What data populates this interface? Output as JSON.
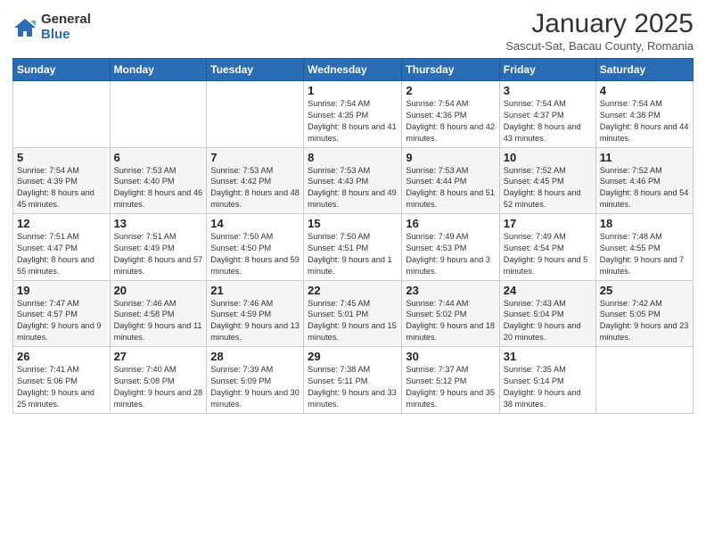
{
  "logo": {
    "general": "General",
    "blue": "Blue"
  },
  "title": "January 2025",
  "subtitle": "Sascut-Sat, Bacau County, Romania",
  "weekdays": [
    "Sunday",
    "Monday",
    "Tuesday",
    "Wednesday",
    "Thursday",
    "Friday",
    "Saturday"
  ],
  "weeks": [
    [
      {
        "day": "",
        "info": ""
      },
      {
        "day": "",
        "info": ""
      },
      {
        "day": "",
        "info": ""
      },
      {
        "day": "1",
        "info": "Sunrise: 7:54 AM\nSunset: 4:35 PM\nDaylight: 8 hours and 41 minutes."
      },
      {
        "day": "2",
        "info": "Sunrise: 7:54 AM\nSunset: 4:36 PM\nDaylight: 8 hours and 42 minutes."
      },
      {
        "day": "3",
        "info": "Sunrise: 7:54 AM\nSunset: 4:37 PM\nDaylight: 8 hours and 43 minutes."
      },
      {
        "day": "4",
        "info": "Sunrise: 7:54 AM\nSunset: 4:38 PM\nDaylight: 8 hours and 44 minutes."
      }
    ],
    [
      {
        "day": "5",
        "info": "Sunrise: 7:54 AM\nSunset: 4:39 PM\nDaylight: 8 hours and 45 minutes."
      },
      {
        "day": "6",
        "info": "Sunrise: 7:53 AM\nSunset: 4:40 PM\nDaylight: 8 hours and 46 minutes."
      },
      {
        "day": "7",
        "info": "Sunrise: 7:53 AM\nSunset: 4:42 PM\nDaylight: 8 hours and 48 minutes."
      },
      {
        "day": "8",
        "info": "Sunrise: 7:53 AM\nSunset: 4:43 PM\nDaylight: 8 hours and 49 minutes."
      },
      {
        "day": "9",
        "info": "Sunrise: 7:53 AM\nSunset: 4:44 PM\nDaylight: 8 hours and 51 minutes."
      },
      {
        "day": "10",
        "info": "Sunrise: 7:52 AM\nSunset: 4:45 PM\nDaylight: 8 hours and 52 minutes."
      },
      {
        "day": "11",
        "info": "Sunrise: 7:52 AM\nSunset: 4:46 PM\nDaylight: 8 hours and 54 minutes."
      }
    ],
    [
      {
        "day": "12",
        "info": "Sunrise: 7:51 AM\nSunset: 4:47 PM\nDaylight: 8 hours and 55 minutes."
      },
      {
        "day": "13",
        "info": "Sunrise: 7:51 AM\nSunset: 4:49 PM\nDaylight: 8 hours and 57 minutes."
      },
      {
        "day": "14",
        "info": "Sunrise: 7:50 AM\nSunset: 4:50 PM\nDaylight: 8 hours and 59 minutes."
      },
      {
        "day": "15",
        "info": "Sunrise: 7:50 AM\nSunset: 4:51 PM\nDaylight: 9 hours and 1 minute."
      },
      {
        "day": "16",
        "info": "Sunrise: 7:49 AM\nSunset: 4:53 PM\nDaylight: 9 hours and 3 minutes."
      },
      {
        "day": "17",
        "info": "Sunrise: 7:49 AM\nSunset: 4:54 PM\nDaylight: 9 hours and 5 minutes."
      },
      {
        "day": "18",
        "info": "Sunrise: 7:48 AM\nSunset: 4:55 PM\nDaylight: 9 hours and 7 minutes."
      }
    ],
    [
      {
        "day": "19",
        "info": "Sunrise: 7:47 AM\nSunset: 4:57 PM\nDaylight: 9 hours and 9 minutes."
      },
      {
        "day": "20",
        "info": "Sunrise: 7:46 AM\nSunset: 4:58 PM\nDaylight: 9 hours and 11 minutes."
      },
      {
        "day": "21",
        "info": "Sunrise: 7:46 AM\nSunset: 4:59 PM\nDaylight: 9 hours and 13 minutes."
      },
      {
        "day": "22",
        "info": "Sunrise: 7:45 AM\nSunset: 5:01 PM\nDaylight: 9 hours and 15 minutes."
      },
      {
        "day": "23",
        "info": "Sunrise: 7:44 AM\nSunset: 5:02 PM\nDaylight: 9 hours and 18 minutes."
      },
      {
        "day": "24",
        "info": "Sunrise: 7:43 AM\nSunset: 5:04 PM\nDaylight: 9 hours and 20 minutes."
      },
      {
        "day": "25",
        "info": "Sunrise: 7:42 AM\nSunset: 5:05 PM\nDaylight: 9 hours and 23 minutes."
      }
    ],
    [
      {
        "day": "26",
        "info": "Sunrise: 7:41 AM\nSunset: 5:06 PM\nDaylight: 9 hours and 25 minutes."
      },
      {
        "day": "27",
        "info": "Sunrise: 7:40 AM\nSunset: 5:08 PM\nDaylight: 9 hours and 28 minutes."
      },
      {
        "day": "28",
        "info": "Sunrise: 7:39 AM\nSunset: 5:09 PM\nDaylight: 9 hours and 30 minutes."
      },
      {
        "day": "29",
        "info": "Sunrise: 7:38 AM\nSunset: 5:11 PM\nDaylight: 9 hours and 33 minutes."
      },
      {
        "day": "30",
        "info": "Sunrise: 7:37 AM\nSunset: 5:12 PM\nDaylight: 9 hours and 35 minutes."
      },
      {
        "day": "31",
        "info": "Sunrise: 7:35 AM\nSunset: 5:14 PM\nDaylight: 9 hours and 38 minutes."
      },
      {
        "day": "",
        "info": ""
      }
    ]
  ]
}
